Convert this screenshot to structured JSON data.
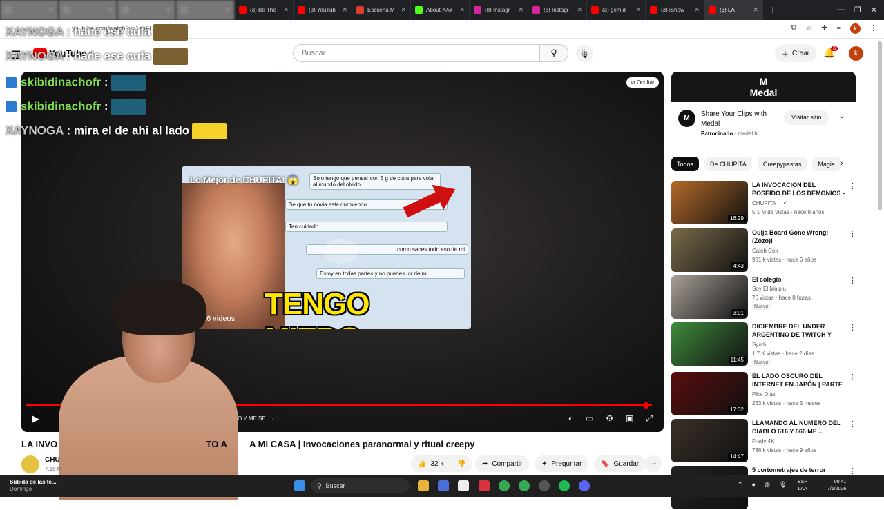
{
  "browser": {
    "tabs": [
      {
        "title": "",
        "color": "#888888",
        "blurred": true
      },
      {
        "title": "",
        "color": "#888888",
        "blurred": true
      },
      {
        "title": "",
        "color": "#888888",
        "blurred": true
      },
      {
        "title": "",
        "color": "#888888",
        "blurred": true
      },
      {
        "title": "(3) Be The",
        "color": "#ff0000"
      },
      {
        "title": "(3) YouTub",
        "color": "#ff0000"
      },
      {
        "title": "Escucha M",
        "color": "#e33b2e"
      },
      {
        "title": "About XAY",
        "color": "#53fc18"
      },
      {
        "title": "(8) Instagr",
        "color": "#d6249f"
      },
      {
        "title": "(8) Instagr",
        "color": "#d6249f"
      },
      {
        "title": "(3) gemid",
        "color": "#ff0000"
      },
      {
        "title": "(3) iShow",
        "color": "#ff0000"
      },
      {
        "title": "(3) LA",
        "color": "#ff0000",
        "active": true
      }
    ],
    "url": "youtube.com/watch?v=1zoFUjie",
    "profile_initial": "k"
  },
  "yt_header": {
    "logo": "YouTube",
    "region": "AR",
    "search_placeholder": "Buscar",
    "create_label": "Crear",
    "notif_count": "3",
    "avatar_initial": "k"
  },
  "player": {
    "hide_label": "Ocultar",
    "endcard_title": "Lo Mejor de CHUPITA! 😱",
    "endcard_big": "TENGO MIEDO",
    "endcard_count": "26 videos",
    "bubbles": [
      "Solo tengo que pensar con 5 g de coca para volar al mundo del olvido",
      "Se que tu novia esta durmiendo",
      "Ten cuidado",
      "como sabes todo eso de mi",
      "Estoy en todas partes y no puedes uir de mi"
    ],
    "chapter": "DAR MUCHO Y ME SE...",
    "progress": 0.99
  },
  "chat": [
    {
      "user": "XAYNOGA",
      "msg": ": hace ese cufa",
      "emote_color": "#7a6030"
    },
    {
      "user": "XAYNOGA",
      "msg": ": hace ese cufa",
      "emote_color": "#7a6030"
    },
    {
      "user": "skibidinachofr",
      "msg": ":",
      "emote_color": "#1e5f7a",
      "badge": true
    },
    {
      "user": "skibidinachofr",
      "msg": ":",
      "emote_color": "#1e5f7a",
      "badge": true
    },
    {
      "user": "XAYNOGA",
      "msg": ": mira el de ahi al lado",
      "emote_color": "#f5d12a"
    }
  ],
  "video": {
    "title_left": "LA INVO",
    "title_mid": "TO A",
    "title_right": "A MI CASA | Invocaciones paranormal y ritual creepy",
    "channel": "CHU",
    "subs": "7.15 M",
    "likes": "32 k",
    "share": "Compartir",
    "ask": "Preguntar",
    "save": "Guardar"
  },
  "ad": {
    "brand": "Medal",
    "title": "Share Your Clips with Medal",
    "sponsored": "Patrocinado",
    "domain": "medal.tv",
    "button": "Visitar sitio"
  },
  "chips": [
    "Todos",
    "De CHUPITA",
    "Creepypastas",
    "Magia"
  ],
  "recommendations": [
    {
      "title": "LA INVOCACION DEL POSEIDO DE LOS DEMONIOS - SE ...",
      "channel": "CHUPITA",
      "verified": true,
      "meta": "5.1 M de vistas · hace 9 años",
      "duration": "16:29",
      "thumb": "#b56a2a"
    },
    {
      "title": "Ouija Board Gone Wrong! (Zozo)!",
      "channel": "Caleb Cox",
      "meta": "931 k vistas · hace 6 años",
      "duration": "4:43",
      "thumb": "#7a6a4a"
    },
    {
      "title": "El colegio",
      "channel": "Soy El Maipiu",
      "meta": "76 vistas · hace 8 horas",
      "badge": "Nuevo",
      "duration": "3:01",
      "thumb": "#a8a097"
    },
    {
      "title": "DICIEMBRE DEL UNDER ARGENTINO DE TWITCH Y KIC...",
      "channel": "Synth",
      "meta": "1.7 K vistas · hace 2 días",
      "badge": "Nuevo",
      "duration": "11:45",
      "thumb": "#3f8a3c"
    },
    {
      "title": "EL LADO OSCURO DEL INTERNET EN JAPÓN | PARTE 2",
      "channel": "Pike Diaz",
      "meta": "263 k vistas · hace 5 meses",
      "duration": "17:32",
      "thumb": "#5a0d0d"
    },
    {
      "title": "LLAMANDO AL NUMERO DEL DIABLO 616 Y 666 ME ...",
      "channel": "Fredy 4K",
      "meta": "736 k vistas · hace 9 años",
      "duration": "14:47",
      "thumb": "#3a3028"
    },
    {
      "title": "5 cortometrajes de terror",
      "channel": "",
      "meta": "",
      "duration": "",
      "thumb": "#222222"
    }
  ],
  "taskbar": {
    "weather_title": "Subida de las te...",
    "weather_sub": "Domingo",
    "search": "Buscar",
    "lang_top": "ESP",
    "lang_bottom": "LAA",
    "time": "00:41",
    "date": "7/1/2026"
  },
  "colors": {
    "accent_red": "#ff0000",
    "chat_green": "#7ddc4f"
  }
}
